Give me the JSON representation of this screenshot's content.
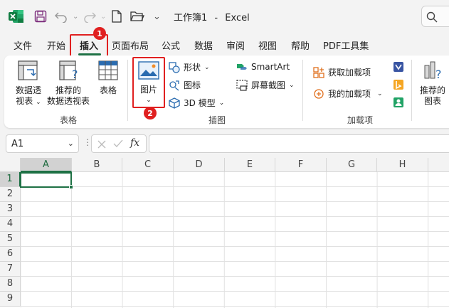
{
  "window": {
    "file_name": "工作簿1",
    "separator": "-",
    "app_name": "Excel"
  },
  "tabs": [
    {
      "label": "文件"
    },
    {
      "label": "开始"
    },
    {
      "label": "插入",
      "active": true
    },
    {
      "label": "页面布局"
    },
    {
      "label": "公式"
    },
    {
      "label": "数据"
    },
    {
      "label": "审阅"
    },
    {
      "label": "视图"
    },
    {
      "label": "帮助"
    },
    {
      "label": "PDF工具集"
    }
  ],
  "callouts": {
    "insert_tab_badge": "1",
    "picture_badge": "2",
    "color": "#e02020"
  },
  "ribbon": {
    "tables": {
      "group_label": "表格",
      "pivot_line1": "数据透",
      "pivot_line2": "视表",
      "recommended_line1": "推荐的",
      "recommended_line2": "数据透视表",
      "table": "表格"
    },
    "illustrations": {
      "group_label": "插图",
      "pictures": "图片",
      "shapes": "形状",
      "icons": "图标",
      "model3d": "3D 模型",
      "smartart": "SmartArt",
      "screenshot": "屏幕截图"
    },
    "addins": {
      "group_label": "加载项",
      "get": "获取加载项",
      "mine": "我的加载项"
    },
    "charts": {
      "recommended_line1": "推荐的",
      "recommended_line2": "图表"
    }
  },
  "formula_bar": {
    "name_box": "A1",
    "fx": "fx",
    "formula": ""
  },
  "sheet": {
    "columns": [
      "A",
      "B",
      "C",
      "D",
      "E",
      "F",
      "G",
      "H"
    ],
    "rows": [
      "1",
      "2",
      "3",
      "4",
      "5",
      "6",
      "7",
      "8",
      "9"
    ],
    "selected_cell": "A1"
  },
  "colors": {
    "accent": "#1e7145",
    "callout": "#e02020"
  }
}
